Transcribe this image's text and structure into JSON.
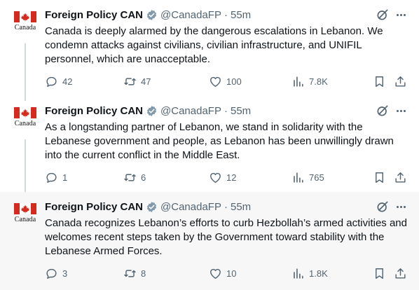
{
  "account": {
    "name": "Foreign Policy CAN",
    "handle": "@CanadaFP",
    "avatar_word": "Canada",
    "flag_red": "#d52b1e"
  },
  "tweets": [
    {
      "time": "55m",
      "text": "Canada is deeply alarmed by the dangerous escalations in Lebanon. We condemn attacks against civilians, civilian infrastructure, and UNIFIL personnel, which are unacceptable.",
      "replies": "42",
      "reposts": "47",
      "likes": "100",
      "views": "7.8K"
    },
    {
      "time": "55m",
      "text": "As a longstanding partner of Lebanon, we stand in solidarity with the Lebanese government and people, as Lebanon has been unwillingly drawn into the current conflict in the Middle East.",
      "replies": "1",
      "reposts": "6",
      "likes": "12",
      "views": "765"
    },
    {
      "time": "55m",
      "text": "Canada recognizes Lebanon’s efforts to curb Hezbollah’s armed activities and welcomes recent steps taken by the Government toward stability with the Lebanese Armed Forces.",
      "replies": "3",
      "reposts": "8",
      "likes": "10",
      "views": "1.8K"
    }
  ],
  "separator": "·",
  "icons": [
    "verified-badge-icon",
    "grok-icon",
    "more-icon",
    "reply-icon",
    "repost-icon",
    "like-icon",
    "views-icon",
    "bookmark-icon",
    "share-icon"
  ],
  "colors": {
    "text": "#0f1419",
    "muted": "#536471",
    "verified": "#829aab",
    "thread_line": "#cfd9de",
    "highlight_bg": "#f7f7f7"
  }
}
